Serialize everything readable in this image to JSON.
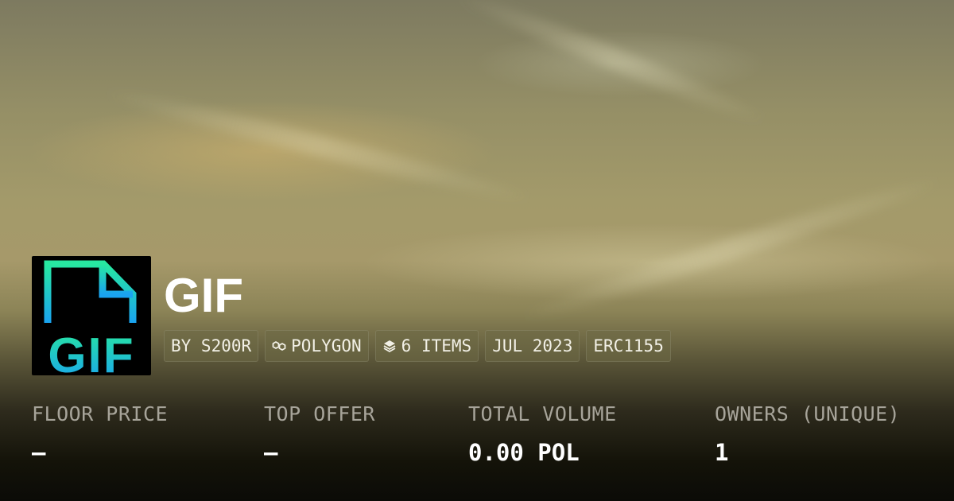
{
  "collection": {
    "name": "GIF",
    "logo_text": "GIF",
    "logo_icon": "file-icon",
    "badges": [
      {
        "label": "BY S200R",
        "icon": ""
      },
      {
        "label": "POLYGON",
        "icon": "polygon-icon"
      },
      {
        "label": "6 ITEMS",
        "icon": "layers-icon"
      },
      {
        "label": "JUL 2023",
        "icon": ""
      },
      {
        "label": "ERC1155",
        "icon": ""
      }
    ]
  },
  "stats": [
    {
      "label": "FLOOR PRICE",
      "value": "–"
    },
    {
      "label": "TOP OFFER",
      "value": "–"
    },
    {
      "label": "TOTAL VOLUME",
      "value": "0.00 POL"
    },
    {
      "label": "OWNERS (UNIQUE)",
      "value": "1"
    }
  ],
  "colors": {
    "logo_gradient_top": "#27e8a0",
    "logo_gradient_bottom": "#1aa3f0",
    "logo_background": "#000000",
    "text_primary": "#ffffff",
    "text_muted": "#a7a49a"
  }
}
